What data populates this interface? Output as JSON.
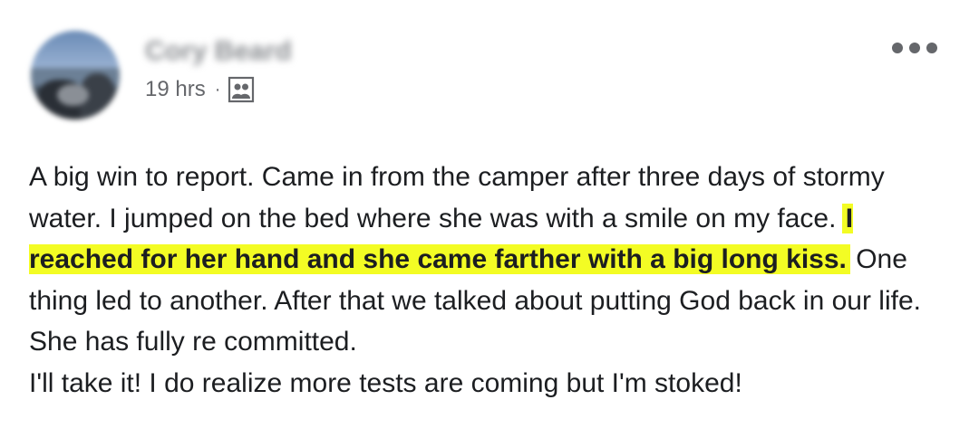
{
  "post": {
    "author_name": "Cory Beard",
    "timestamp": "19 hrs",
    "separator": "·",
    "audience_icon": "friends-group-icon",
    "more_icon": "more-options-icon",
    "text": {
      "part1": "A big win to report. Came in from the camper after three days of stormy water. I jumped on the bed where she was with a smile on my face. ",
      "highlight": "I reached for her hand and she came farther with a big long kiss.",
      "part2": " One thing led to another. After that we talked about putting God back in our life. She has fully re committed.",
      "part3": "I'll take it! I do realize more tests are coming but I'm stoked!"
    },
    "highlight_color": "#f3fc24"
  }
}
